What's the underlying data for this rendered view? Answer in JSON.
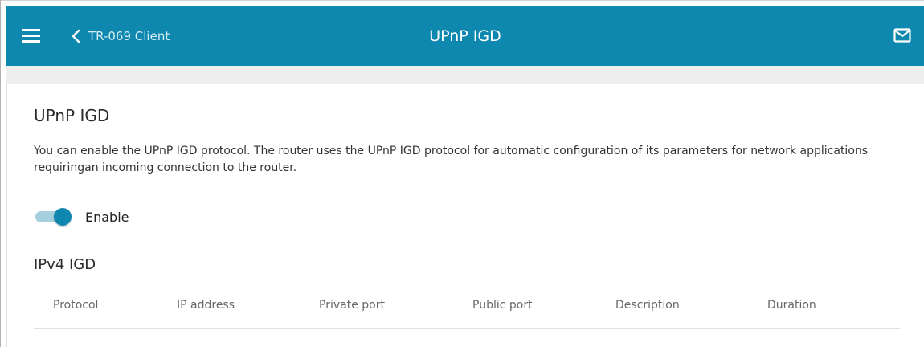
{
  "header": {
    "back_label": "TR-069 Client",
    "title": "UPnP IGD",
    "menu_icon": "hamburger-menu-icon",
    "back_icon": "chevron-left-icon",
    "mail_icon": "mail-icon"
  },
  "section": {
    "title": "UPnP IGD",
    "description": "You can enable the UPnP IGD protocol. The router uses the UPnP IGD protocol for automatic configuration of its parameters for network applications requiringan incoming connection to the router."
  },
  "enable_toggle": {
    "label": "Enable",
    "checked": true
  },
  "ipv4": {
    "title": "IPv4 IGD",
    "columns": [
      "Protocol",
      "IP address",
      "Private port",
      "Public port",
      "Description",
      "Duration"
    ],
    "rows": []
  },
  "colors": {
    "header_bg": "#0e88ae",
    "toggle_track": "#a6cfdd",
    "toggle_knob": "#0e88ae"
  }
}
